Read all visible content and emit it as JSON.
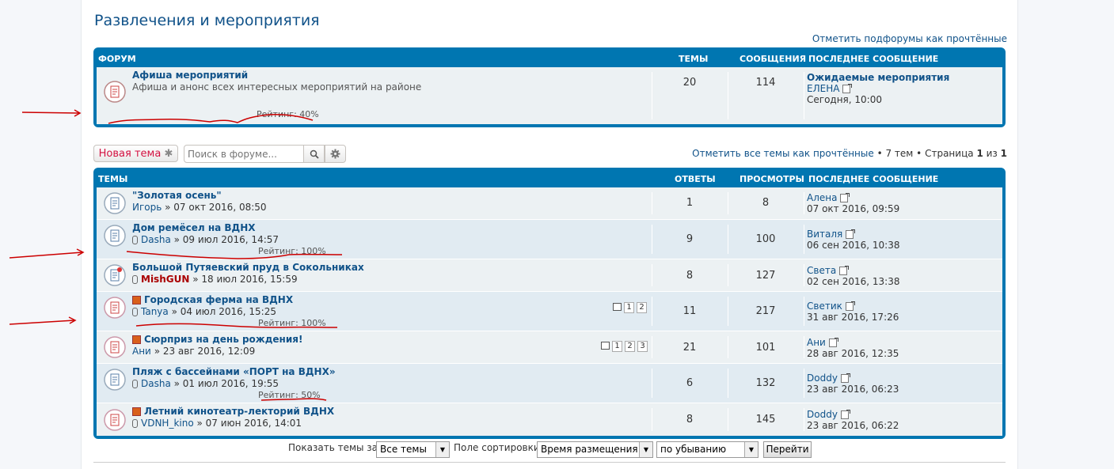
{
  "page": {
    "title": "Развлечения и мероприятия",
    "mark_subforums_read": "Отметить подфорумы как прочтённые"
  },
  "forums": {
    "headers": {
      "name": "ФОРУМ",
      "topics": "ТЕМЫ",
      "posts": "СООБЩЕНИЯ",
      "last": "ПОСЛЕДНЕЕ СООБЩЕНИЕ"
    },
    "rows": [
      {
        "title": "Афиша мероприятий",
        "desc": "Афиша и анонс всех интересных мероприятий на районе",
        "rating": "Рейтинг: 40%",
        "topics": "20",
        "posts": "114",
        "last_title": "Ожидаемые мероприятия",
        "last_author": "ЕЛЕНА",
        "last_time": "Сегодня, 10:00"
      }
    ]
  },
  "toolbar": {
    "new_topic": "Новая тема",
    "search_placeholder": "Поиск в форуме...",
    "mark_topics_read": "Отметить все темы как прочтённые",
    "topic_count": "• 7 тем •",
    "page_label": "Страница",
    "page_current": "1",
    "page_of": "из",
    "page_total": "1"
  },
  "topics": {
    "headers": {
      "name": "ТЕМЫ",
      "replies": "ОТВЕТЫ",
      "views": "ПРОСМОТРЫ",
      "last": "ПОСЛЕДНЕЕ СООБЩЕНИЕ"
    },
    "rows": [
      {
        "title": "\"Золотая осень\"",
        "author": "Игорь",
        "date": "» 07 окт 2016, 08:50",
        "rating": "",
        "replies": "1",
        "views": "8",
        "last_author": "Алена",
        "last_time": "07 окт 2016, 09:59"
      },
      {
        "title": "Дом ремёсел на ВДНХ",
        "author": "Dasha",
        "date": "» 09 июл 2016, 14:57",
        "rating": "Рейтинг: 100%",
        "replies": "9",
        "views": "100",
        "last_author": "Виталя",
        "last_time": "06 сен 2016, 10:38"
      },
      {
        "title": "Большой Путяевский пруд в Сокольниках",
        "author": "MishGUN",
        "date": "» 18 июл 2016, 15:59",
        "rating": "",
        "replies": "8",
        "views": "127",
        "last_author": "Света",
        "last_time": "02 сен 2016, 13:38"
      },
      {
        "title": "Городская ферма на ВДНХ",
        "author": "Tanya",
        "date": "» 04 июл 2016, 15:25",
        "rating": "Рейтинг: 100%",
        "replies": "11",
        "views": "217",
        "last_author": "Светик",
        "last_time": "31 авг 2016, 17:26",
        "pages": [
          "1",
          "2"
        ]
      },
      {
        "title": "Сюрприз на день рождения!",
        "author": "Ани",
        "date": "» 23 авг 2016, 12:09",
        "rating": "",
        "replies": "21",
        "views": "101",
        "last_author": "Ани",
        "last_time": "28 авг 2016, 12:35",
        "pages": [
          "1",
          "2",
          "3"
        ]
      },
      {
        "title": "Пляж с бассейнами «ПОРТ на ВДНХ»",
        "author": "Dasha",
        "date": "» 01 июл 2016, 19:55",
        "rating": "Рейтинг: 50%",
        "replies": "6",
        "views": "132",
        "last_author": "Doddy",
        "last_time": "23 авг 2016, 06:23"
      },
      {
        "title": "Летний кинотеатр-лекторий ВДНХ",
        "author": "VDNH_kino",
        "date": "» 07 июн 2016, 14:01",
        "rating": "",
        "replies": "8",
        "views": "145",
        "last_author": "Doddy",
        "last_time": "23 авг 2016, 06:22"
      }
    ]
  },
  "footer": {
    "show_label": "Показать темы за:",
    "show_value": "Все темы",
    "sort_label": "Поле сортировки",
    "sort_value": "Время размещения",
    "order_value": "по убыванию",
    "go": "Перейти"
  },
  "colors": {
    "accent": "#105289",
    "header": "#0076b1",
    "row": "#ecf1f3",
    "new_topic": "#d31141",
    "annotation": "#cc0000"
  }
}
